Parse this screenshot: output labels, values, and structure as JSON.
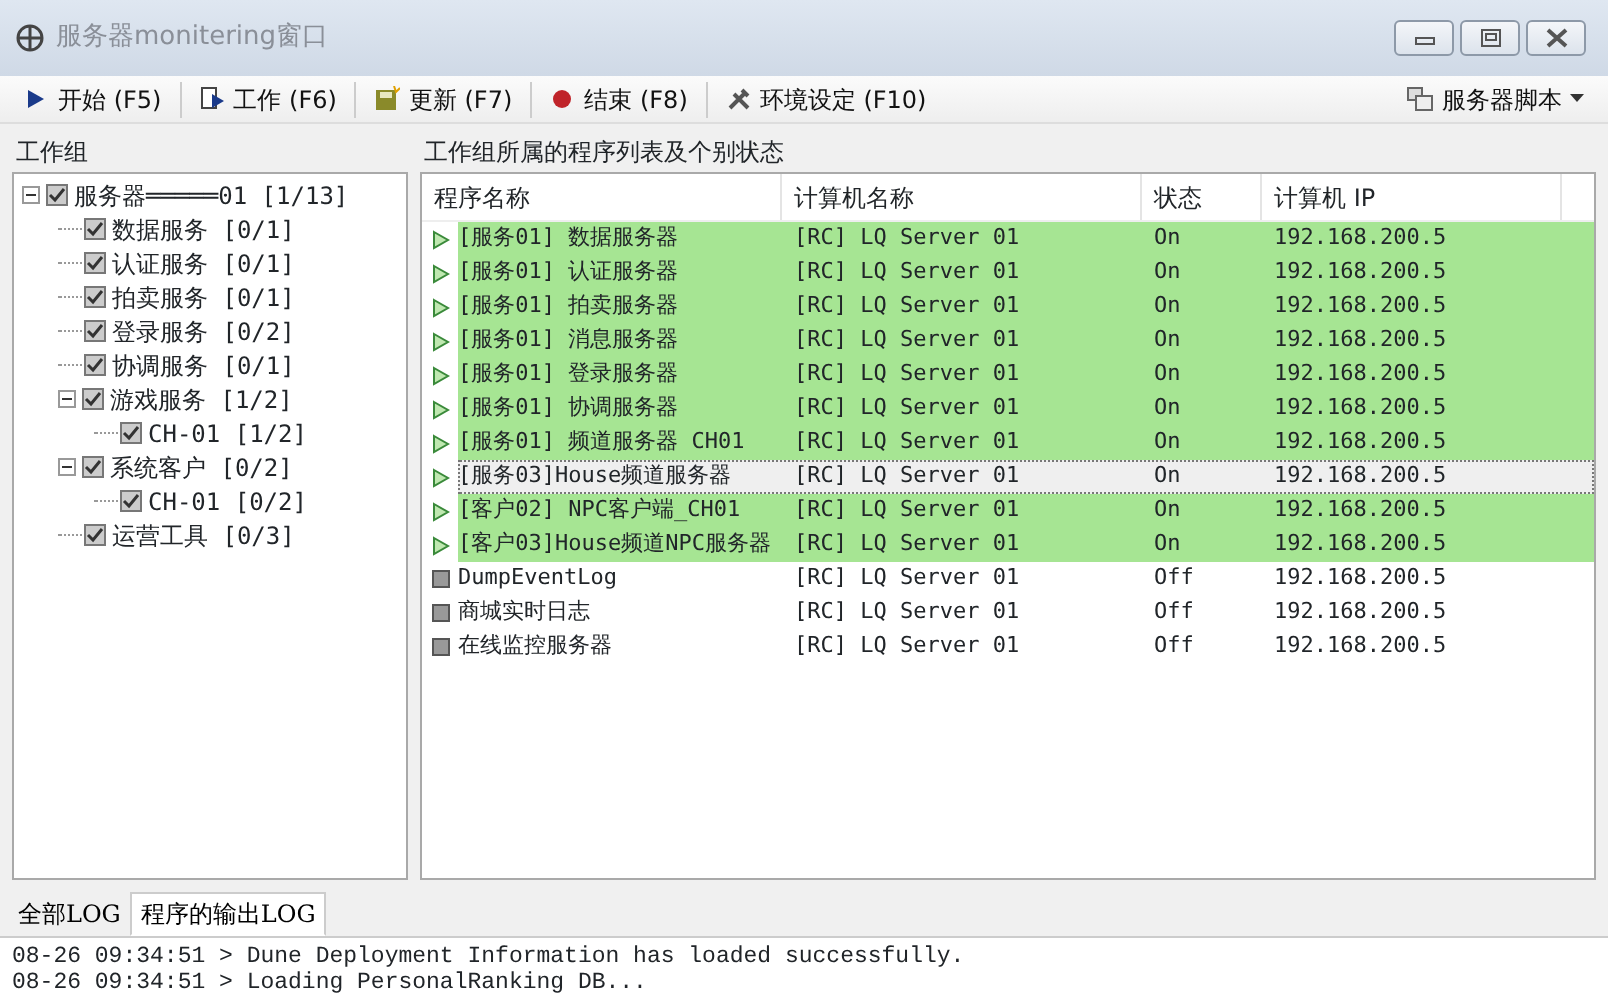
{
  "window": {
    "title": "服务器monitering窗口"
  },
  "toolbar": [
    {
      "label": "开始 (F5)",
      "kind": "start"
    },
    {
      "label": "工作 (F6)",
      "kind": "work"
    },
    {
      "label": "更新 (F7)",
      "kind": "update"
    },
    {
      "label": "结束 (F8)",
      "kind": "stop"
    },
    {
      "label": "环境设定 (F10)",
      "kind": "settings"
    }
  ],
  "script_menu": {
    "label": "服务器脚本"
  },
  "group_panel": {
    "title": "工作组",
    "tree": [
      {
        "label": "服务器═════01 [1/13]",
        "checked": true,
        "expanded": true,
        "children": [
          {
            "label": "数据服务 [0/1]",
            "checked": true
          },
          {
            "label": "认证服务 [0/1]",
            "checked": true
          },
          {
            "label": "拍卖服务 [0/1]",
            "checked": true
          },
          {
            "label": "登录服务 [0/2]",
            "checked": true
          },
          {
            "label": "协调服务 [0/1]",
            "checked": true
          },
          {
            "label": "游戏服务 [1/2]",
            "checked": true,
            "expanded": true,
            "children": [
              {
                "label": "CH-01 [1/2]",
                "checked": true
              }
            ]
          },
          {
            "label": "系统客户 [0/2]",
            "checked": true,
            "expanded": true,
            "children": [
              {
                "label": "CH-01 [0/2]",
                "checked": true
              }
            ]
          },
          {
            "label": "运营工具 [0/3]",
            "checked": true
          }
        ]
      }
    ]
  },
  "list_panel": {
    "title": "工作组所属的程序列表及个别状态",
    "columns": [
      "程序名称",
      "计算机名称",
      "状态",
      "计算机 IP"
    ],
    "rows": [
      {
        "kind": "running",
        "highlighted": true,
        "selected": false,
        "cells": [
          "[服务01] 数据服务器",
          "[RC] LQ Server 01",
          "On",
          "192.168.200.5"
        ]
      },
      {
        "kind": "running",
        "highlighted": true,
        "selected": false,
        "cells": [
          "[服务01] 认证服务器",
          "[RC] LQ Server 01",
          "On",
          "192.168.200.5"
        ]
      },
      {
        "kind": "running",
        "highlighted": true,
        "selected": false,
        "cells": [
          "[服务01] 拍卖服务器",
          "[RC] LQ Server 01",
          "On",
          "192.168.200.5"
        ]
      },
      {
        "kind": "running",
        "highlighted": true,
        "selected": false,
        "cells": [
          "[服务01] 消息服务器",
          "[RC] LQ Server 01",
          "On",
          "192.168.200.5"
        ]
      },
      {
        "kind": "running",
        "highlighted": true,
        "selected": false,
        "cells": [
          "[服务01] 登录服务器",
          "[RC] LQ Server 01",
          "On",
          "192.168.200.5"
        ]
      },
      {
        "kind": "running",
        "highlighted": true,
        "selected": false,
        "cells": [
          "[服务01] 协调服务器",
          "[RC] LQ Server 01",
          "On",
          "192.168.200.5"
        ]
      },
      {
        "kind": "running",
        "highlighted": true,
        "selected": false,
        "cells": [
          "[服务01] 频道服务器 CH01",
          "[RC] LQ Server 01",
          "On",
          "192.168.200.5"
        ]
      },
      {
        "kind": "running",
        "highlighted": false,
        "selected": true,
        "cells": [
          "[服务03]House频道服务器",
          "[RC] LQ Server 01",
          "On",
          "192.168.200.5"
        ]
      },
      {
        "kind": "running",
        "highlighted": true,
        "selected": false,
        "cells": [
          "[客户02] NPC客户端_CH01",
          "[RC] LQ Server 01",
          "On",
          "192.168.200.5"
        ]
      },
      {
        "kind": "running",
        "highlighted": true,
        "selected": false,
        "cells": [
          "[客户03]House频道NPC服务器",
          "[RC] LQ Server 01",
          "On",
          "192.168.200.5"
        ]
      },
      {
        "kind": "stopped",
        "highlighted": false,
        "selected": false,
        "cells": [
          "DumpEventLog",
          "[RC] LQ Server 01",
          "Off",
          "192.168.200.5"
        ]
      },
      {
        "kind": "stopped",
        "highlighted": false,
        "selected": false,
        "cells": [
          "商城实时日志",
          "[RC] LQ Server 01",
          "Off",
          "192.168.200.5"
        ]
      },
      {
        "kind": "stopped",
        "highlighted": false,
        "selected": false,
        "cells": [
          "在线监控服务器",
          "[RC] LQ Server 01",
          "Off",
          "192.168.200.5"
        ]
      }
    ]
  },
  "log_tabs": [
    {
      "label": "全部LOG",
      "selected": false
    },
    {
      "label": "程序的输出LOG",
      "selected": true
    }
  ],
  "log_lines": [
    "08-26 09:34:51 > Dune Deployment Information has loaded successfully.",
    "08-26 09:34:51 > Loading PersonalRanking DB..."
  ]
}
